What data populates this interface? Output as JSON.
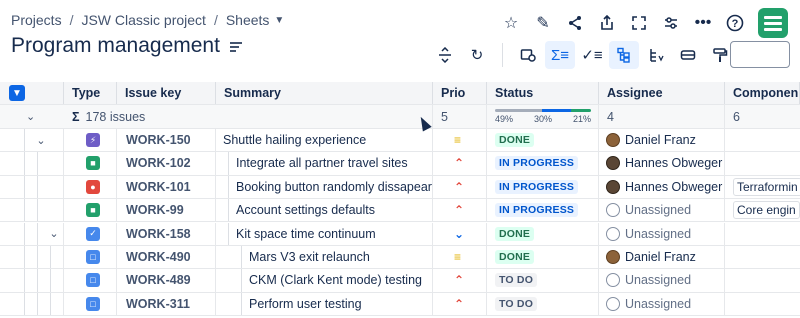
{
  "breadcrumb": {
    "projects": "Projects",
    "project": "JSW Classic project",
    "sheets": "Sheets"
  },
  "page_title": "Program management",
  "search": {
    "placeholder": ""
  },
  "columns": {
    "type": "Type",
    "key": "Issue key",
    "summary": "Summary",
    "prio": "Prio",
    "status": "Status",
    "assignee": "Assignee",
    "components": "Componen"
  },
  "summary_row": {
    "issues": "178 issues",
    "prio": "5",
    "status_pcts": [
      "49%",
      "30%",
      "21%"
    ],
    "status_fractions": [
      0.49,
      0.3,
      0.21
    ],
    "assignee": "4",
    "components": "6"
  },
  "colors": {
    "todo": "#a5adba",
    "progress": "#0c66e4",
    "done": "#22a06b",
    "accent": "#0c66e4"
  },
  "rows": [
    {
      "key": "WORK-150",
      "summary": "Shuttle hailing experience",
      "status": "DONE",
      "assignee": "Daniel Franz",
      "component": "",
      "type_icon": "lightning-icon",
      "prio_icon": "medium-priority-icon"
    },
    {
      "key": "WORK-102",
      "summary": "Integrate all partner travel sites",
      "status": "IN PROGRESS",
      "assignee": "Hannes Obweger",
      "component": "",
      "type_icon": "story-icon",
      "prio_icon": "highest-priority-icon"
    },
    {
      "key": "WORK-101",
      "summary": "Booking button randomly dissapears",
      "status": "IN PROGRESS",
      "assignee": "Hannes Obweger",
      "component": "Terraformin",
      "type_icon": "bug-icon",
      "prio_icon": "highest-priority-icon"
    },
    {
      "key": "WORK-99",
      "summary": "Account settings defaults",
      "status": "IN PROGRESS",
      "assignee": "Unassigned",
      "component": "Core engin",
      "type_icon": "story-icon",
      "prio_icon": "high-priority-icon"
    },
    {
      "key": "WORK-158",
      "summary": "Kit space time continuum",
      "status": "DONE",
      "assignee": "Unassigned",
      "component": "",
      "type_icon": "task-icon",
      "prio_icon": "lowest-priority-icon"
    },
    {
      "key": "WORK-490",
      "summary": "Mars V3 exit relaunch",
      "status": "DONE",
      "assignee": "Daniel Franz",
      "component": "",
      "type_icon": "subtask-icon",
      "prio_icon": "medium-priority-icon"
    },
    {
      "key": "WORK-489",
      "summary": "CKM (Clark Kent mode) testing",
      "status": "TO DO",
      "assignee": "Unassigned",
      "component": "",
      "type_icon": "subtask-icon",
      "prio_icon": "highest-priority-icon"
    },
    {
      "key": "WORK-311",
      "summary": "Perform user testing",
      "status": "TO DO",
      "assignee": "Unassigned",
      "component": "",
      "type_icon": "subtask-icon",
      "prio_icon": "highest-priority-icon"
    }
  ]
}
